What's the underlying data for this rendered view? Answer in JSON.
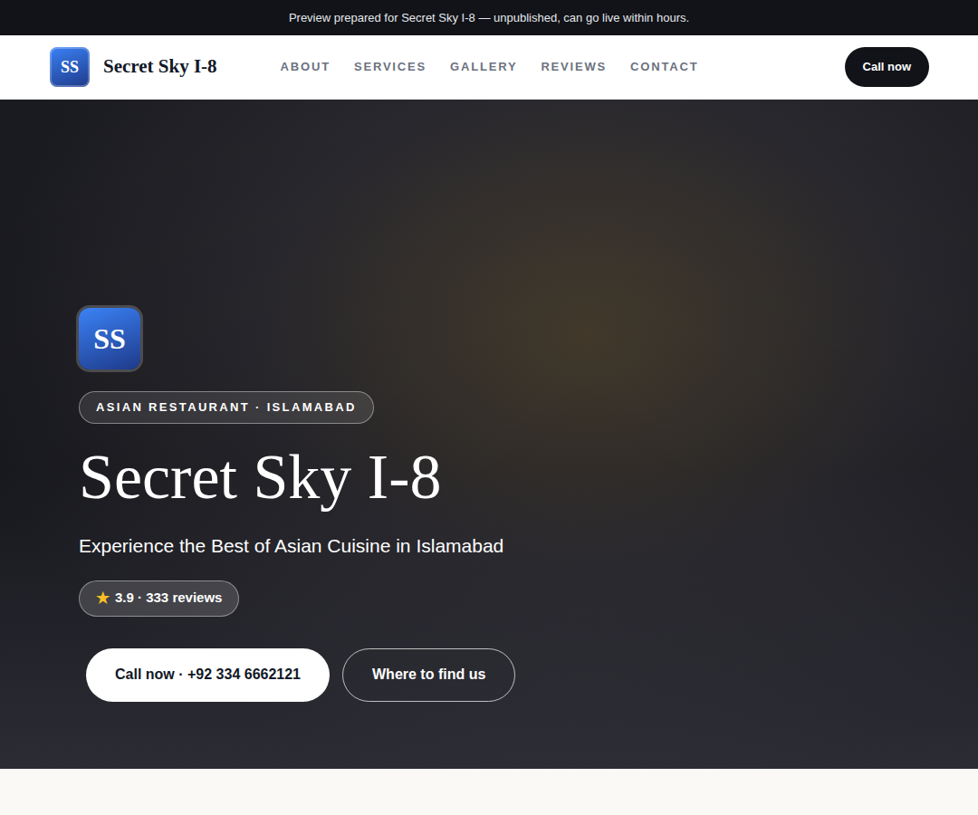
{
  "banner": "Preview prepared for Secret Sky I-8 — unpublished, can go live within hours.",
  "header": {
    "logo": "SS",
    "brand": "Secret Sky I-8",
    "nav": [
      "ABOUT",
      "SERVICES",
      "GALLERY",
      "REVIEWS",
      "CONTACT"
    ],
    "call_button": "Call now"
  },
  "hero": {
    "logo": "SS",
    "category": "ASIAN RESTAURANT · ISLAMABAD",
    "title": "Secret Sky I-8",
    "subtitle": "Experience the Best of Asian Cuisine in Islamabad",
    "rating": {
      "icon": "★",
      "text": "3.9 · 333 reviews"
    },
    "buttons": [
      "Call now · +92 334 6662121",
      "Where to find us"
    ]
  }
}
